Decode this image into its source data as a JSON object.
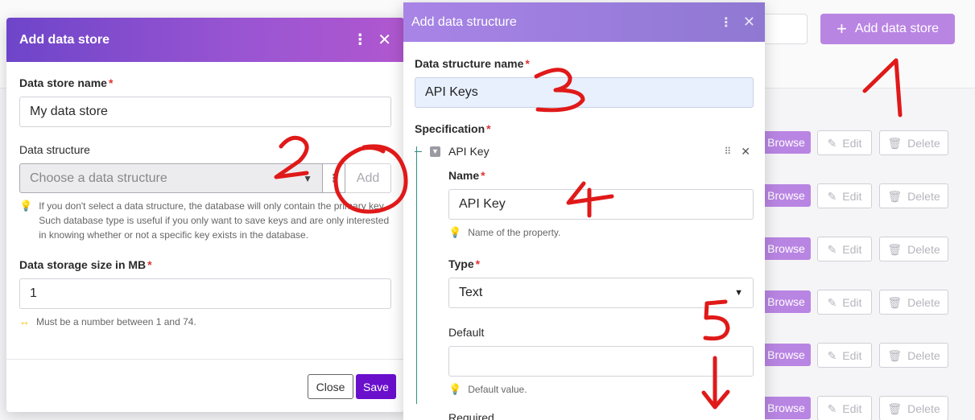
{
  "background": {
    "add_button": {
      "label": "Add data store",
      "icon": "plus-icon"
    },
    "rows": [
      {
        "browse": "Browse",
        "edit": "Edit",
        "delete": "Delete"
      },
      {
        "browse": "Browse",
        "edit": "Edit",
        "delete": "Delete"
      },
      {
        "browse": "Browse",
        "edit": "Edit",
        "delete": "Delete"
      },
      {
        "browse": "Browse",
        "edit": "Edit",
        "delete": "Delete"
      },
      {
        "browse": "Browse",
        "edit": "Edit",
        "delete": "Delete"
      },
      {
        "browse": "Browse",
        "edit": "Edit",
        "delete": "Delete"
      }
    ]
  },
  "add_store_modal": {
    "title": "Add data store",
    "store_name": {
      "label": "Data store name",
      "value": "My data store"
    },
    "data_structure": {
      "label": "Data structure",
      "placeholder": "Choose a data structure",
      "add_label": "Add",
      "hint": "If you don't select a data structure, the database will only contain the primary key. Such database type is useful if you only want to save keys and are only interested in knowing whether or not a specific key exists in the database."
    },
    "storage_size": {
      "label": "Data storage size in MB",
      "value": "1",
      "hint": "Must be a number between 1 and 74."
    },
    "close_label": "Close",
    "save_label": "Save"
  },
  "add_structure_modal": {
    "title": "Add data structure",
    "name": {
      "label": "Data structure name",
      "value": "API Keys"
    },
    "specification": {
      "label": "Specification",
      "item_name": "API Key",
      "name_field": {
        "label": "Name",
        "value": "API Key",
        "hint": "Name of the property."
      },
      "type_field": {
        "label": "Type",
        "value": "Text"
      },
      "default_field": {
        "label": "Default",
        "value": "",
        "hint": "Default value."
      },
      "required_label": "Required"
    }
  },
  "annotations": [
    "1",
    "2",
    "3",
    "4",
    "5"
  ],
  "colors": {
    "accent": "#6a0fcc",
    "header_left": "#7a47cc",
    "header_right": "#a07fe0",
    "browse": "#b985e3",
    "annotation": "#e01919"
  }
}
